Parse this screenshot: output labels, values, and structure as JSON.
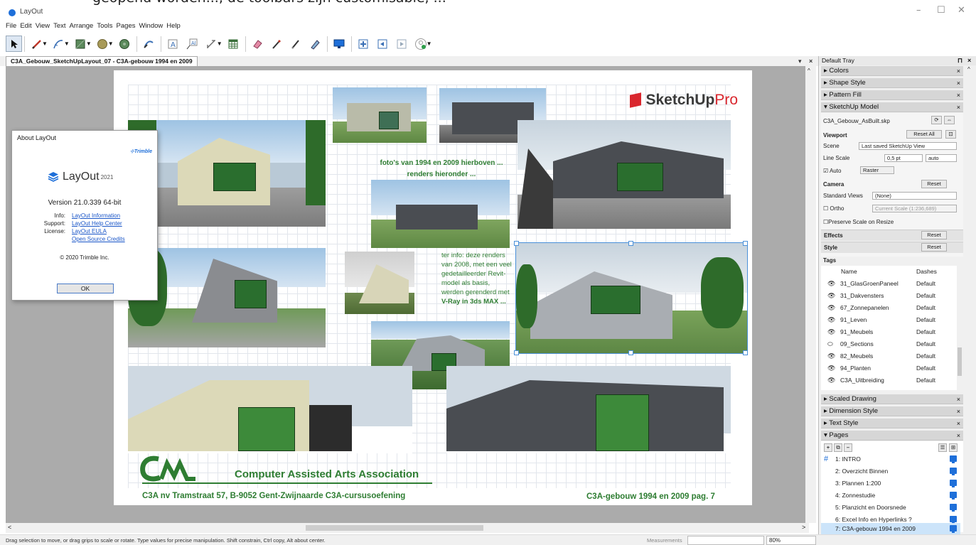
{
  "window": {
    "bleed_text": "geopend worden..., de toolbars zijn customisable, ...",
    "title": "LayOut",
    "minimize": "–",
    "maximize": "☐",
    "close": "✕"
  },
  "menu": [
    "File",
    "Edit",
    "View",
    "Text",
    "Arrange",
    "Tools",
    "Pages",
    "Window",
    "Help"
  ],
  "tab": {
    "label": "C3A_Gebouw_SketchUpLayout_07 - C3A-gebouw 1994 en 2009",
    "dropdown": "▾",
    "close": "×"
  },
  "document": {
    "caption_top": "foto's van 1994 en 2009 hierboven ...",
    "caption_top2": "renders hieronder ...",
    "info_lines": [
      "ter info: deze renders",
      "van 2008, met een veel",
      "gedetailleerder Revit-",
      "model als basis,",
      "werden gerenderd met",
      "V-Ray in 3ds MAX ..."
    ],
    "sketchup_logo": "SketchUp",
    "sketchup_pro": "Pro",
    "org_name": "Computer Assisted Arts Association",
    "org_address": "C3A nv  Tramstraat 57, B-9052 Gent-Zwijnaarde    C3A-cursusoefening",
    "page_label": "C3A-gebouw 1994 en 2009   pag.  7"
  },
  "about": {
    "title": "About LayOut",
    "trimble": "⊹Trimble",
    "product": "LayOut",
    "year": "2021",
    "version": "Version 21.0.339 64-bit",
    "info_label": "Info:",
    "info_link": "LayOut Information",
    "support_label": "Support:",
    "support_link": "LayOut Help Center",
    "license_label": "License:",
    "license_link": "LayOut EULA",
    "credits_link": "Open Source Credits",
    "copyright": "© 2020 Trimble Inc.",
    "ok": "OK"
  },
  "tray": {
    "title": "Default Tray",
    "panels_top": [
      "▸ Colors",
      "▸ Shape Style",
      "▸ Pattern Fill",
      "▾ SketchUp Model"
    ],
    "model_file": "C3A_Gebouw_AsBuilt.skp",
    "viewport": "Viewport",
    "reset_all": "Reset All",
    "scene_label": "Scene",
    "scene_value": "Last saved SketchUp View",
    "line_scale_label": "Line Scale",
    "line_scale_value": "0,5 pt",
    "line_scale_mode": "auto",
    "auto_label": "Auto",
    "raster": "Raster",
    "camera": "Camera",
    "reset": "Reset",
    "std_views_label": "Standard Views",
    "std_views_value": "(None)",
    "ortho_label": "Ortho",
    "ortho_value": "Current Scale (1:236,689)",
    "preserve": "Preserve Scale on Resize",
    "effects": "Effects",
    "style": "Style",
    "tags": "Tags",
    "tag_col_name": "Name",
    "tag_col_dashes": "Dashes",
    "tags_list": [
      {
        "name": "31_GlasGroenPaneel",
        "dash": "Default",
        "icon": "👁"
      },
      {
        "name": "31_Dakvensters",
        "dash": "Default",
        "icon": "👁"
      },
      {
        "name": "67_Zonnepanelen",
        "dash": "Default",
        "icon": "👁"
      },
      {
        "name": "91_Leven",
        "dash": "Default",
        "icon": "👁"
      },
      {
        "name": "91_Meubels",
        "dash": "Default",
        "icon": "👁"
      },
      {
        "name": "09_Sections",
        "dash": "Default",
        "icon": "⬭"
      },
      {
        "name": "82_Meubels",
        "dash": "Default",
        "icon": "👁"
      },
      {
        "name": "94_Planten",
        "dash": "Default",
        "icon": "👁"
      },
      {
        "name": "C3A_Uitbreiding",
        "dash": "Default",
        "icon": "👁"
      }
    ],
    "panels_bottom": [
      "▸ Scaled Drawing",
      "▸ Dimension Style",
      "▸ Text Style",
      "▾ Pages"
    ],
    "pages": [
      "1: INTRO",
      "2: Overzicht Binnen",
      "3: Plannen 1:200",
      "4: Zonnestudie",
      "5: Planzicht en Doorsnede",
      "6: Excel Info en Hyperlinks ?",
      "7: C3A-gebouw 1994 en 2009"
    ]
  },
  "status": {
    "hint": "Drag selection to move, or drag grips to scale or rotate. Type values for precise manipulation. Shift constrain, Ctrl copy, Alt about center.",
    "measurements": "Measurements",
    "zoom": "80%"
  },
  "colors": {
    "accent": "#2e7d32",
    "brand_red": "#d9272e",
    "canvas": "#ababab",
    "selection": "#4a90d9"
  }
}
